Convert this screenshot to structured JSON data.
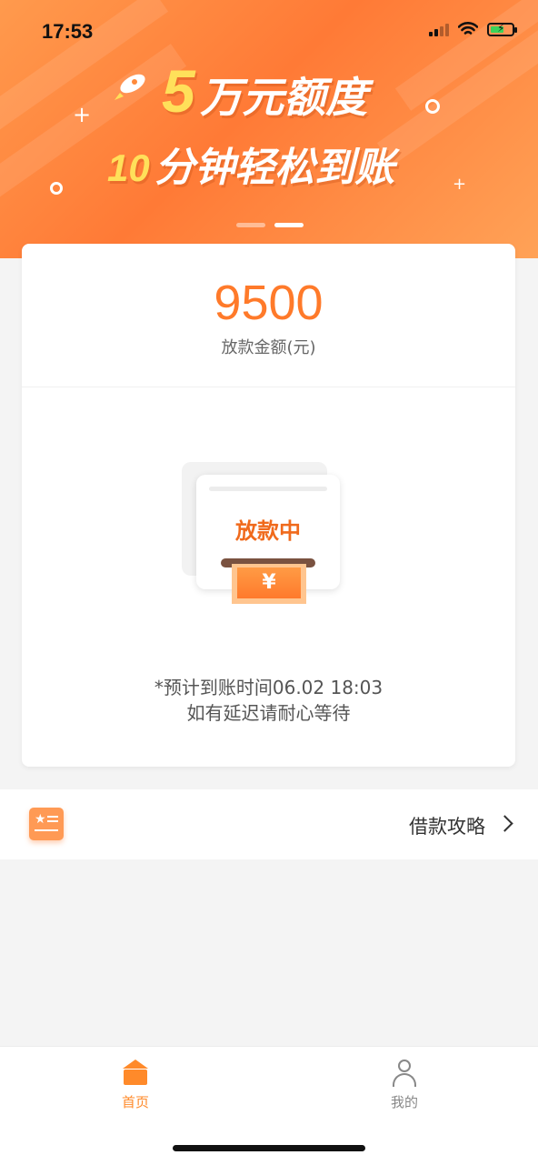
{
  "status_bar": {
    "time": "17:53"
  },
  "banner": {
    "line1_number": "5",
    "line1_text": "万元额度",
    "line2_number": "10",
    "line2_text": "分钟轻松到账",
    "slide_count": 2,
    "active_slide": 2
  },
  "loan": {
    "amount": "9500",
    "amount_label": "放款金额(元)",
    "status_text": "放款中",
    "currency_symbol": "¥",
    "notice_line1": "*预计到账时间06.02 18:03",
    "notice_line2": "如有延迟请耐心等待"
  },
  "guide": {
    "label": "借款攻略"
  },
  "tabbar": {
    "tabs": [
      {
        "label": "首页",
        "icon": "home-icon",
        "active": true
      },
      {
        "label": "我的",
        "icon": "user-icon",
        "active": false
      }
    ]
  },
  "colors": {
    "accent": "#ff7a2a",
    "tab_active": "#ff8a2a",
    "tab_inactive": "#888888"
  }
}
